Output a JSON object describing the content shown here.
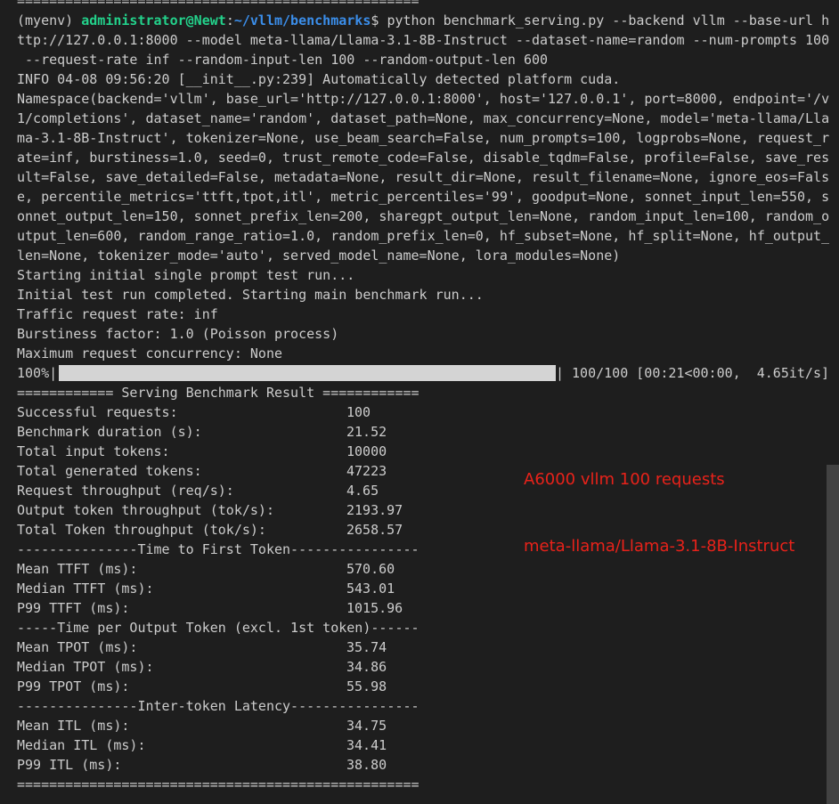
{
  "top_rule": "==================================================",
  "command": {
    "env": "(myenv) ",
    "user": "administrator@Newt",
    "colon": ":",
    "path": "~/vllm/benchmarks",
    "prompt": "$ ",
    "lines": [
      "python benchmark_serving.py --backend vllm --base-url h",
      "ttp://127.0.0.1:8000 --model meta-llama/Llama-3.1-8B-Instruct --dataset-name=random --num-prompts 100",
      " --request-rate inf --random-input-len 100 --random-output-len 600"
    ]
  },
  "info_line": "INFO 04-08 09:56:20 [__init__.py:239] Automatically detected platform cuda.",
  "namespace_lines": [
    "Namespace(backend='vllm', base_url='http://127.0.0.1:8000', host='127.0.0.1', port=8000, endpoint='/v",
    "1/completions', dataset_name='random', dataset_path=None, max_concurrency=None, model='meta-llama/Lla",
    "ma-3.1-8B-Instruct', tokenizer=None, use_beam_search=False, num_prompts=100, logprobs=None, request_r",
    "ate=inf, burstiness=1.0, seed=0, trust_remote_code=False, disable_tqdm=False, profile=False, save_res",
    "ult=False, save_detailed=False, metadata=None, result_dir=None, result_filename=None, ignore_eos=Fals",
    "e, percentile_metrics='ttft,tpot,itl', metric_percentiles='99', goodput=None, sonnet_input_len=550, s",
    "onnet_output_len=150, sonnet_prefix_len=200, sharegpt_output_len=None, random_input_len=100, random_o",
    "utput_len=600, random_range_ratio=1.0, random_prefix_len=0, hf_subset=None, hf_split=None, hf_output_",
    "len=None, tokenizer_mode='auto', served_model_name=None, lora_modules=None)"
  ],
  "status_lines": [
    "Starting initial single prompt test run...",
    "Initial test run completed. Starting main benchmark run...",
    "Traffic request rate: inf",
    "Burstiness factor: 1.0 (Poisson process)",
    "Maximum request concurrency: None"
  ],
  "progress": {
    "percent_label": "100%|",
    "fraction": 1.0,
    "suffix": "| 100/100 [00:21<00:00,  4.65it/s]"
  },
  "result_header": "============ Serving Benchmark Result ============",
  "results": [
    {
      "key": "Successful requests:",
      "value": "100"
    },
    {
      "key": "Benchmark duration (s):",
      "value": "21.52"
    },
    {
      "key": "Total input tokens:",
      "value": "10000"
    },
    {
      "key": "Total generated tokens:",
      "value": "47223"
    },
    {
      "key": "Request throughput (req/s):",
      "value": "4.65"
    },
    {
      "key": "Output token throughput (tok/s):",
      "value": "2193.97"
    },
    {
      "key": "Total Token throughput (tok/s):",
      "value": "2658.57"
    }
  ],
  "ttft_header": "---------------Time to First Token----------------",
  "ttft": [
    {
      "key": "Mean TTFT (ms):",
      "value": "570.60"
    },
    {
      "key": "Median TTFT (ms):",
      "value": "543.01"
    },
    {
      "key": "P99 TTFT (ms):",
      "value": "1015.96"
    }
  ],
  "tpot_header": "-----Time per Output Token (excl. 1st token)------",
  "tpot": [
    {
      "key": "Mean TPOT (ms):",
      "value": "35.74"
    },
    {
      "key": "Median TPOT (ms):",
      "value": "34.86"
    },
    {
      "key": "P99 TPOT (ms):",
      "value": "55.98"
    }
  ],
  "itl_header": "---------------Inter-token Latency----------------",
  "itl": [
    {
      "key": "Mean ITL (ms):",
      "value": "34.75"
    },
    {
      "key": "Median ITL (ms):",
      "value": "34.41"
    },
    {
      "key": "P99 ITL (ms):",
      "value": "38.80"
    }
  ],
  "bottom_rule": "==================================================",
  "annotation": {
    "line1": "A6000 vllm 100 requests",
    "line2": "meta-llama/Llama-3.1-8B-Instruct"
  },
  "colors": {
    "background": "#1e1e1e",
    "text": "#cccccc",
    "user": "#23d18b",
    "path": "#3b8eea",
    "annotation": "#e8221a",
    "progress_fill": "#d4d4d4"
  }
}
